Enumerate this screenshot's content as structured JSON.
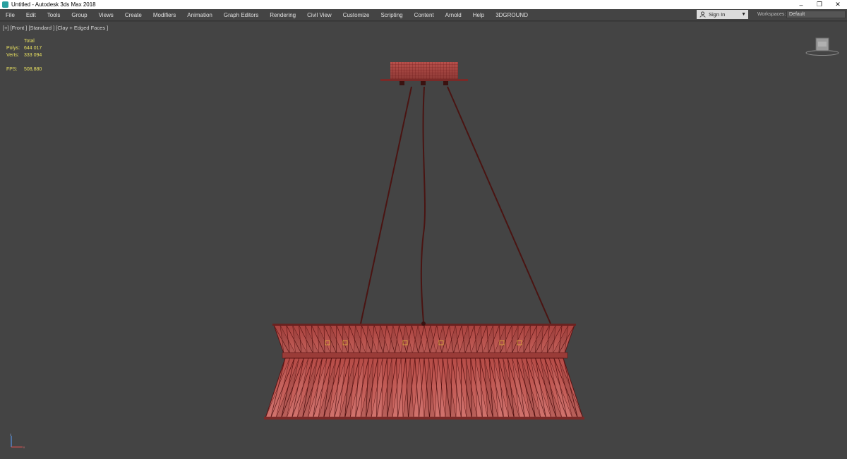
{
  "window": {
    "title": "Untitled - Autodesk 3ds Max 2018",
    "icon": "3dsmax-app-icon",
    "controls": {
      "minimize": "–",
      "restore": "❐",
      "close": "✕"
    }
  },
  "menu": [
    {
      "label": "File"
    },
    {
      "label": "Edit"
    },
    {
      "label": "Tools"
    },
    {
      "label": "Group"
    },
    {
      "label": "Views"
    },
    {
      "label": "Create"
    },
    {
      "label": "Modifiers"
    },
    {
      "label": "Animation"
    },
    {
      "label": "Graph Editors"
    },
    {
      "label": "Rendering"
    },
    {
      "label": "Civil View"
    },
    {
      "label": "Customize"
    },
    {
      "label": "Scripting"
    },
    {
      "label": "Content"
    },
    {
      "label": "Arnold"
    },
    {
      "label": "Help"
    },
    {
      "label": "3DGROUND"
    }
  ],
  "account": {
    "signin_label": "Sign In"
  },
  "workspace": {
    "label": "Workspaces:",
    "value": "Default"
  },
  "viewport": {
    "label": "[+] [Front ] [Standard ] [Clay + Edged Faces ]",
    "stats": {
      "header": "Total",
      "polys_label": "Polys:",
      "polys_value": "644 017",
      "verts_label": "Verts:",
      "verts_value": "333 094",
      "fps_label": "FPS:",
      "fps_value": "508,880"
    },
    "object_color": "#b84a45",
    "wire_color": "#5a1414"
  }
}
